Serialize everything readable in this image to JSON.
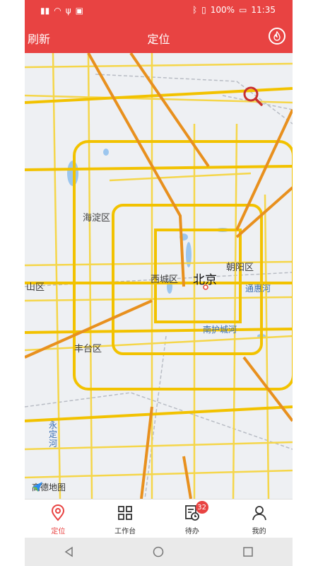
{
  "status_bar": {
    "battery": "100%",
    "time": "11:35"
  },
  "app_bar": {
    "refresh_label": "刷新",
    "title": "定位"
  },
  "map": {
    "labels": {
      "haidian": "海淀区",
      "beijing": "北京",
      "xicheng": "西城区",
      "chaoyang": "朝阳区",
      "shijingshan": "山区",
      "tonghuihe": "通惠河",
      "nanhucheng": "南护城河",
      "fengtai": "丰台区",
      "yongdinghe": "永定河"
    },
    "provider": "高德地图"
  },
  "tabs": [
    {
      "label": "定位",
      "active": true,
      "icon": "location-pin-icon"
    },
    {
      "label": "工作台",
      "icon": "grid-icon"
    },
    {
      "label": "待办",
      "icon": "todo-icon",
      "badge": "32"
    },
    {
      "label": "我的",
      "icon": "user-icon"
    }
  ],
  "colors": {
    "accent": "#e84342",
    "road_major": "#f5c51b",
    "road_express": "#e8901e"
  }
}
